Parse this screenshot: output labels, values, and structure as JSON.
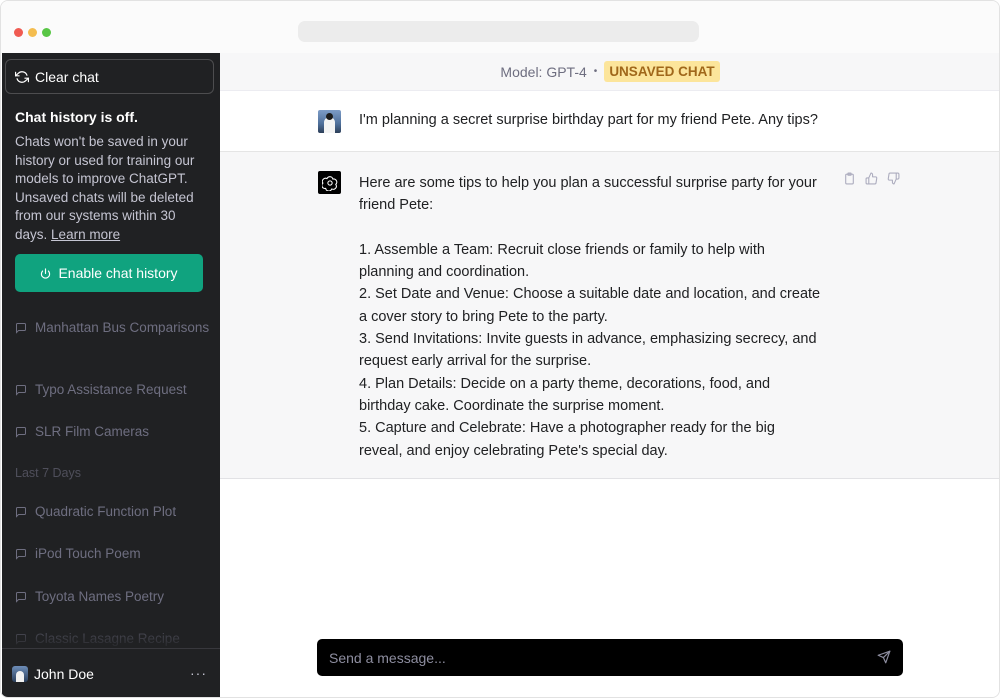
{
  "sidebar": {
    "clear_chat_label": "Clear chat",
    "history_off_title": "Chat history is off.",
    "history_off_desc": "Chats won't be saved in your history or used for training our models to improve ChatGPT. Unsaved chats will be deleted from our systems within 30 days.",
    "learn_more": "Learn more",
    "enable_label": "Enable chat history",
    "recent_chats": [
      "Manhattan Bus Comparisons",
      "Typo Assistance Request",
      "SLR Film Cameras"
    ],
    "section_label": "Last 7 Days",
    "week_chats": [
      "Quadratic Function Plot",
      "iPod Touch Poem",
      "Toyota Names Poetry",
      "Classic Lasagne Recipe"
    ],
    "user_name": "John Doe",
    "more": "···"
  },
  "header": {
    "model_label": "Model: GPT-4",
    "bullet": "•",
    "unsaved_badge": "UNSAVED CHAT"
  },
  "conversation": {
    "user_message": "I'm planning a secret surprise birthday part for my friend Pete. Any tips?",
    "assistant_intro": "Here are some tips to help you plan a successful surprise party for your friend Pete:",
    "assistant_tips": [
      "1. Assemble a Team: Recruit close friends or family to help with planning and coordination.",
      "2. Set Date and Venue: Choose a suitable date and location, and create a cover story to bring Pete to the party.",
      "3. Send Invitations: Invite guests in advance, emphasizing secrecy, and request early arrival for the surprise.",
      "4. Plan Details: Decide on a party theme, decorations, food, and birthday cake. Coordinate the surprise moment.",
      "5. Capture and Celebrate: Have a photographer ready for the big reveal, and enjoy celebrating Pete's special day."
    ]
  },
  "composer": {
    "placeholder": "Send a message..."
  },
  "colors": {
    "sidebar_bg": "#202123",
    "accent": "#10a37f",
    "badge_bg": "#fce59b",
    "badge_text": "#a0671a"
  },
  "icons": {
    "clear": "refresh-icon",
    "enable": "power-icon",
    "chat": "chat-bubble-icon",
    "copy": "clipboard-icon",
    "like": "thumbs-up-icon",
    "dislike": "thumbs-down-icon",
    "send": "send-icon"
  }
}
